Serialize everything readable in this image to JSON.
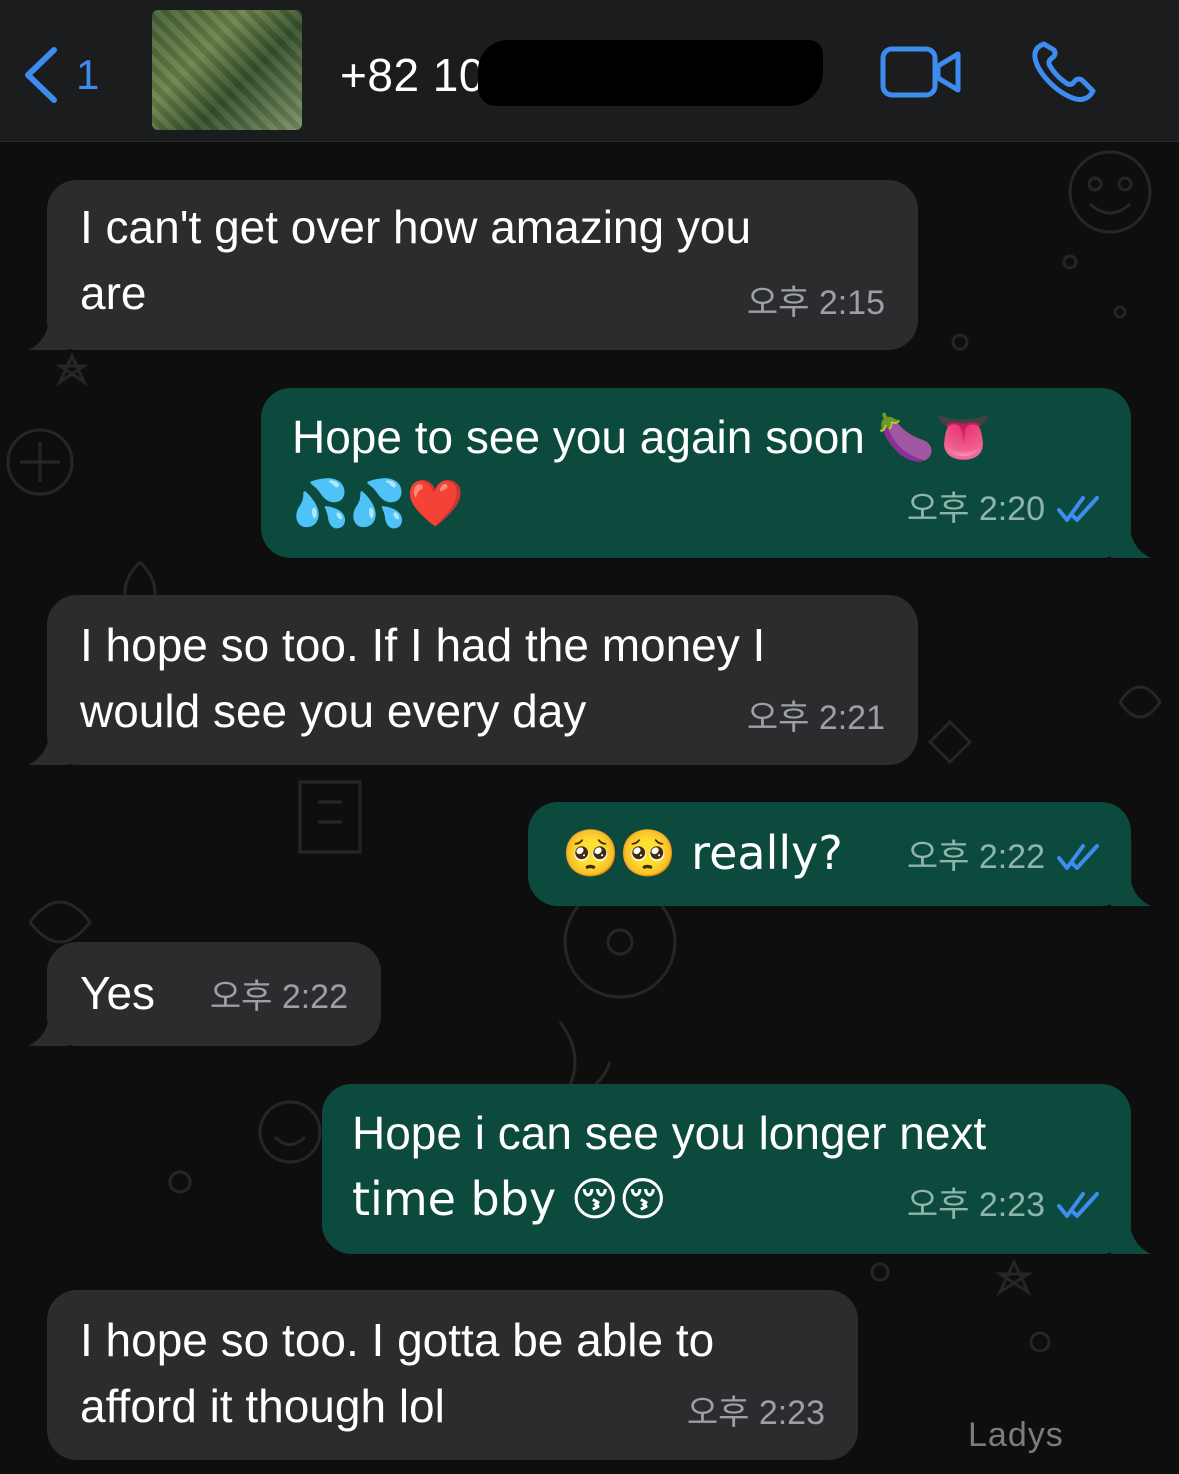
{
  "header": {
    "back_count": "1",
    "contact_name": "+82 10",
    "accent_color": "#3d8cf0"
  },
  "messages": [
    {
      "direction": "incoming",
      "lines": [
        "I can't get over how amazing you",
        "are"
      ],
      "time": "오후 2:15"
    },
    {
      "direction": "outgoing",
      "lines": [
        "Hope to see you again soon 🍆👅",
        "💦💦❤️"
      ],
      "time": "오후 2:20",
      "status": "read-double-check"
    },
    {
      "direction": "incoming",
      "lines": [
        "I hope so too. If I had the money I",
        "would see you every day"
      ],
      "time": "오후 2:21"
    },
    {
      "direction": "outgoing",
      "lines": [
        "🥺🥺 really?"
      ],
      "time": "오후 2:22",
      "status": "read-double-check"
    },
    {
      "direction": "incoming",
      "lines": [
        "Yes"
      ],
      "time": "오후 2:22"
    },
    {
      "direction": "outgoing",
      "lines": [
        "Hope i can see you longer next",
        "time bby 😚😚"
      ],
      "time": "오후 2:23",
      "status": "read-double-check"
    },
    {
      "direction": "incoming",
      "lines": [
        "I hope so too. I gotta be able to",
        "afford it though lol"
      ],
      "time": "오후 2:23"
    }
  ],
  "watermark": "Ladys",
  "colors": {
    "incoming_bubble": "#2c2c2e",
    "outgoing_bubble": "#0c4a3e",
    "read_tick": "#3d8cf0"
  },
  "icons": [
    "chevron-left-icon",
    "video-camera-icon",
    "phone-icon",
    "double-check-icon"
  ]
}
